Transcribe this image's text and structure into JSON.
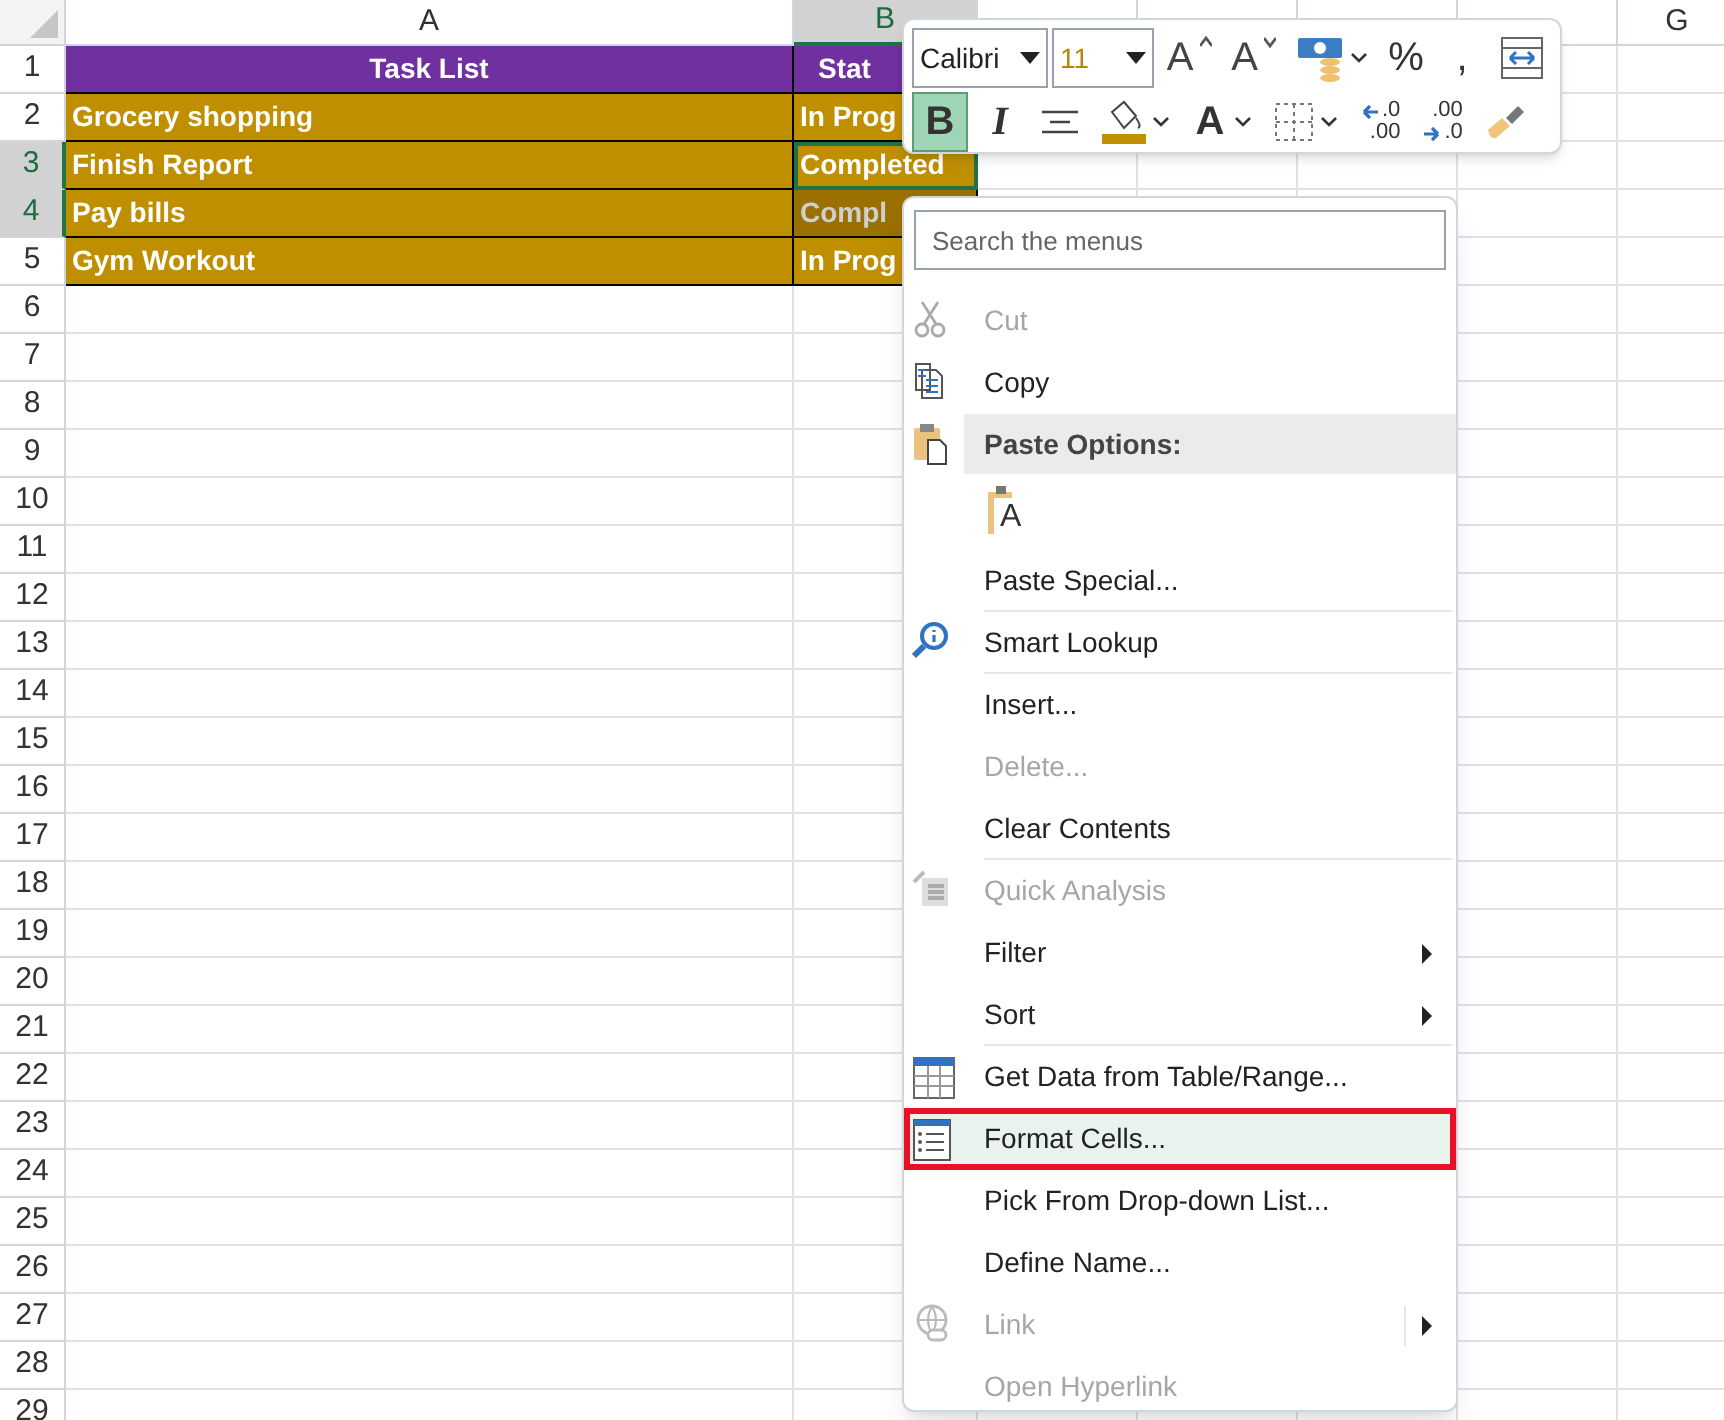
{
  "sheet": {
    "columns": [
      {
        "label": "A",
        "selected": false
      },
      {
        "label": "B",
        "selected": true
      },
      {
        "selected": false
      },
      {
        "selected": false
      },
      {
        "selected": false
      },
      {
        "selected": false
      },
      {
        "label": "G",
        "selected": false
      }
    ],
    "row_headers": [
      {
        "label": "1",
        "selected": false
      },
      {
        "label": "2",
        "selected": false
      },
      {
        "label": "3",
        "selected": true
      },
      {
        "label": "4",
        "selected": true
      },
      {
        "label": "5",
        "selected": false
      },
      {
        "label": "6",
        "selected": false
      },
      {
        "label": "7",
        "selected": false
      },
      {
        "label": "8",
        "selected": false
      },
      {
        "label": "9",
        "selected": false
      },
      {
        "label": "10",
        "selected": false
      },
      {
        "label": "11",
        "selected": false
      },
      {
        "label": "12",
        "selected": false
      },
      {
        "label": "13",
        "selected": false
      },
      {
        "label": "14",
        "selected": false
      },
      {
        "label": "15",
        "selected": false
      },
      {
        "label": "16",
        "selected": false
      },
      {
        "label": "17",
        "selected": false
      },
      {
        "label": "18",
        "selected": false
      },
      {
        "label": "19",
        "selected": false
      },
      {
        "label": "20",
        "selected": false
      },
      {
        "label": "21",
        "selected": false
      },
      {
        "label": "22",
        "selected": false
      },
      {
        "label": "23",
        "selected": false
      },
      {
        "label": "24",
        "selected": false
      },
      {
        "label": "25",
        "selected": false
      },
      {
        "label": "26",
        "selected": false
      },
      {
        "label": "27",
        "selected": false
      },
      {
        "label": "28",
        "selected": false
      },
      {
        "label": "29",
        "selected": false
      }
    ],
    "rows": [
      {
        "kind": "header",
        "cells": [
          {
            "text": "Task List",
            "active": false,
            "selected": false
          },
          {
            "text": "Stat",
            "active": false,
            "selected": false
          }
        ]
      },
      {
        "kind": "data",
        "cells": [
          {
            "text": "Grocery shopping",
            "active": false,
            "selected": false
          },
          {
            "text": "In Prog",
            "active": false,
            "selected": false
          }
        ]
      },
      {
        "kind": "data",
        "cells": [
          {
            "text": "Finish Report",
            "active": false,
            "selected": false
          },
          {
            "text": "Completed",
            "active": true,
            "selected": false
          }
        ]
      },
      {
        "kind": "data",
        "cells": [
          {
            "text": "Pay bills",
            "active": false,
            "selected": false
          },
          {
            "text": "Compl",
            "active": false,
            "selected": true
          }
        ]
      },
      {
        "kind": "data",
        "cells": [
          {
            "text": "Gym Workout",
            "active": false,
            "selected": false
          },
          {
            "text": "In Prog",
            "active": false,
            "selected": false
          }
        ]
      }
    ]
  },
  "toolbar": {
    "font": "Calibri",
    "size": "11",
    "row_1": [
      {
        "kind": "grow-font",
        "label": "A",
        "selected": false,
        "dropdown": false
      },
      {
        "kind": "shrink-font",
        "label": "A",
        "selected": false,
        "dropdown": false
      },
      {
        "kind": "accounting",
        "selected": false,
        "dropdown": true
      },
      {
        "kind": "text",
        "label": "%",
        "selected": false,
        "dropdown": false
      },
      {
        "kind": "text",
        "label": ",",
        "selected": false,
        "dropdown": false
      },
      {
        "kind": "wrap",
        "selected": false,
        "dropdown": false
      }
    ],
    "row_2": [
      {
        "kind": "bold",
        "label": "B",
        "selected": true,
        "dropdown": false
      },
      {
        "kind": "italic",
        "label": "I",
        "selected": false,
        "dropdown": false
      },
      {
        "kind": "align-center",
        "selected": false,
        "dropdown": false
      },
      {
        "kind": "fill-color",
        "color": "#c09000",
        "selected": false,
        "dropdown": true
      },
      {
        "kind": "font-color",
        "label": "A",
        "selected": false,
        "dropdown": true
      },
      {
        "kind": "borders",
        "selected": false,
        "dropdown": true
      },
      {
        "kind": "increase-decimal",
        "top": ".0",
        "bottom": ".00",
        "selected": false,
        "dropdown": false
      },
      {
        "kind": "decrease-decimal",
        "top": ".00",
        "bottom": ".0",
        "selected": false,
        "dropdown": false
      },
      {
        "kind": "format-painter",
        "selected": false,
        "dropdown": false
      }
    ]
  },
  "context_menu": {
    "search": {
      "placeholder": "Search the menus"
    },
    "items": [
      {
        "kind": "item",
        "label": "Cut",
        "disabled": true,
        "selected": false,
        "submenu": false,
        "separator_after": false
      },
      {
        "kind": "item",
        "label": "Copy",
        "disabled": false,
        "selected": false,
        "submenu": false,
        "separator_after": false
      },
      {
        "kind": "header",
        "label": "Paste Options:"
      },
      {
        "kind": "paste-option",
        "label": "A"
      },
      {
        "kind": "item",
        "label": "Paste Special...",
        "disabled": false,
        "selected": false,
        "submenu": false,
        "separator_after": true
      },
      {
        "kind": "item",
        "label": "Smart Lookup",
        "disabled": false,
        "selected": false,
        "submenu": false,
        "separator_after": true
      },
      {
        "kind": "item",
        "label": "Insert...",
        "disabled": false,
        "selected": false,
        "submenu": false,
        "separator_after": false
      },
      {
        "kind": "item",
        "label": "Delete...",
        "disabled": true,
        "selected": false,
        "submenu": false,
        "separator_after": false
      },
      {
        "kind": "item",
        "label": "Clear Contents",
        "disabled": false,
        "selected": false,
        "submenu": false,
        "separator_after": true
      },
      {
        "kind": "item",
        "label": "Quick Analysis",
        "disabled": true,
        "selected": false,
        "submenu": false,
        "separator_after": false
      },
      {
        "kind": "item",
        "label": "Filter",
        "disabled": false,
        "selected": false,
        "submenu": true,
        "separator_after": false
      },
      {
        "kind": "item",
        "label": "Sort",
        "disabled": false,
        "selected": false,
        "submenu": true,
        "separator_after": true
      },
      {
        "kind": "item",
        "label": "Get Data from Table/Range...",
        "disabled": false,
        "selected": false,
        "submenu": false,
        "separator_after": false
      },
      {
        "kind": "item",
        "label": "Format Cells...",
        "disabled": false,
        "selected": true,
        "submenu": false,
        "separator_after": false
      },
      {
        "kind": "item",
        "label": "Pick From Drop-down List...",
        "disabled": false,
        "selected": false,
        "submenu": false,
        "separator_after": false
      },
      {
        "kind": "item",
        "label": "Define Name...",
        "disabled": false,
        "selected": false,
        "submenu": false,
        "separator_after": false
      },
      {
        "kind": "item",
        "label": "Link",
        "disabled": true,
        "selected": false,
        "submenu": true,
        "separator_after": false
      },
      {
        "kind": "item",
        "label": "Open Hyperlink",
        "disabled": true,
        "selected": false,
        "submenu": false,
        "separator_after": false
      }
    ]
  }
}
